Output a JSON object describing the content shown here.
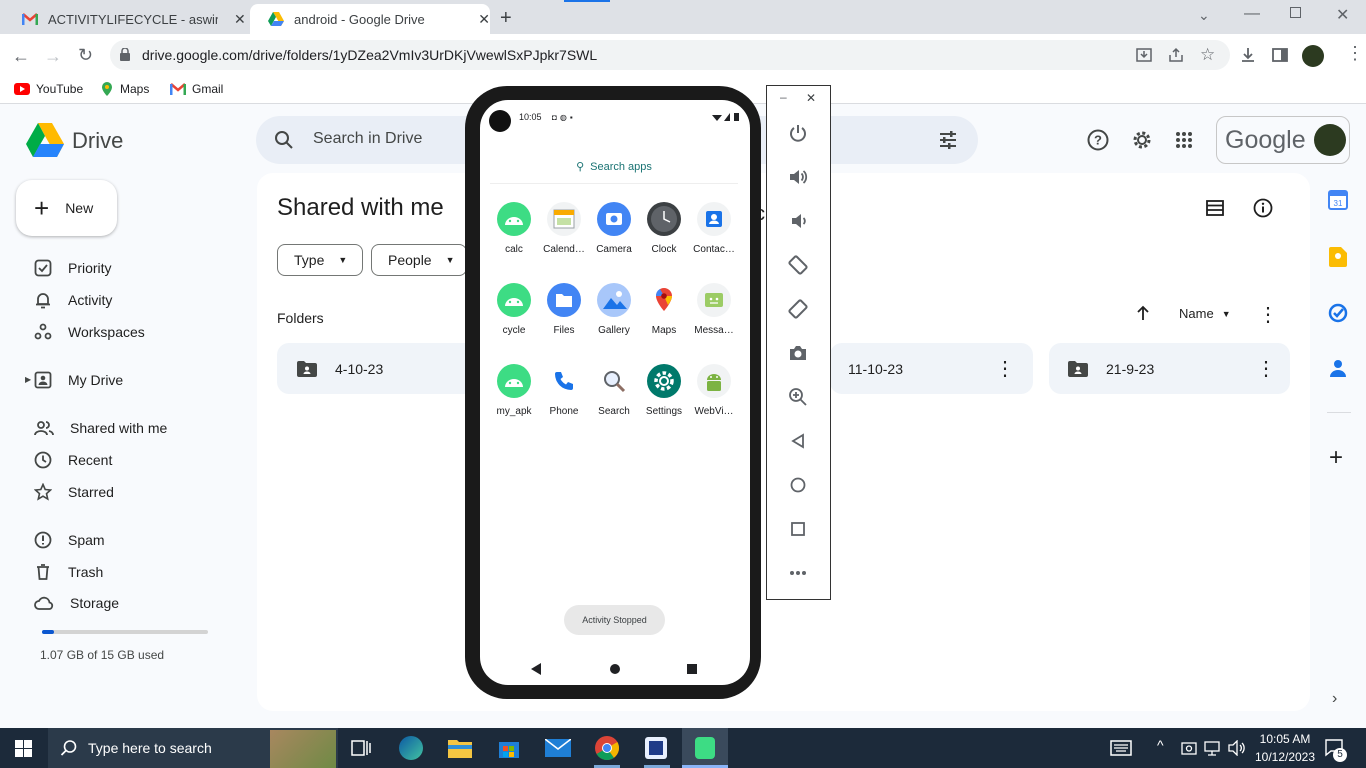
{
  "browser": {
    "tabs": [
      {
        "title": "ACTIVITYLIFECYCLE - aswinksinu",
        "icon": "gmail-icon"
      },
      {
        "title": "android - Google Drive",
        "icon": "drive-icon"
      }
    ],
    "url": "drive.google.com/drive/folders/1yDZea2VmIv3UrDKjVwewlSxPJpkr7SWL",
    "bookmarks": [
      {
        "label": "YouTube"
      },
      {
        "label": "Maps"
      },
      {
        "label": "Gmail"
      }
    ]
  },
  "drive": {
    "app_name": "Drive",
    "search_placeholder": "Search in Drive",
    "new_label": "New",
    "account_label": "Google",
    "nav": [
      {
        "label": "Priority"
      },
      {
        "label": "Activity"
      },
      {
        "label": "Workspaces"
      },
      {
        "label": "My Drive"
      },
      {
        "label": "Shared with me"
      },
      {
        "label": "Recent"
      },
      {
        "label": "Starred"
      },
      {
        "label": "Spam"
      },
      {
        "label": "Trash"
      },
      {
        "label": "Storage"
      }
    ],
    "storage_text": "1.07 GB of 15 GB used",
    "storage_fraction": 0.071,
    "page_title": "Shared with me",
    "filters": [
      {
        "label": "Type"
      },
      {
        "label": "People"
      }
    ],
    "section_title": "Folders",
    "sort_label": "Name",
    "folders": [
      {
        "name": "4-10-23"
      },
      {
        "name": "11-10-23"
      },
      {
        "name": "21-9-23"
      }
    ]
  },
  "phone": {
    "time": "10:05",
    "search_label": "Search apps",
    "apps": [
      {
        "label": "calc"
      },
      {
        "label": "Calend…"
      },
      {
        "label": "Camera"
      },
      {
        "label": "Clock"
      },
      {
        "label": "Contac…"
      },
      {
        "label": "cycle"
      },
      {
        "label": "Files"
      },
      {
        "label": "Gallery"
      },
      {
        "label": "Maps"
      },
      {
        "label": "Messa…"
      },
      {
        "label": "my_apk"
      },
      {
        "label": "Phone"
      },
      {
        "label": "Search"
      },
      {
        "label": "Settings"
      },
      {
        "label": "WebVi…"
      }
    ],
    "toast": "Activity Stopped"
  },
  "taskbar": {
    "search_placeholder": "Type here to search",
    "time": "10:05 AM",
    "date": "10/12/2023",
    "notifications": "5"
  },
  "colors": {
    "drive_blue": "#0b57d0",
    "taskbar": "#1c2a3a",
    "android_green": "#3ddc84"
  }
}
